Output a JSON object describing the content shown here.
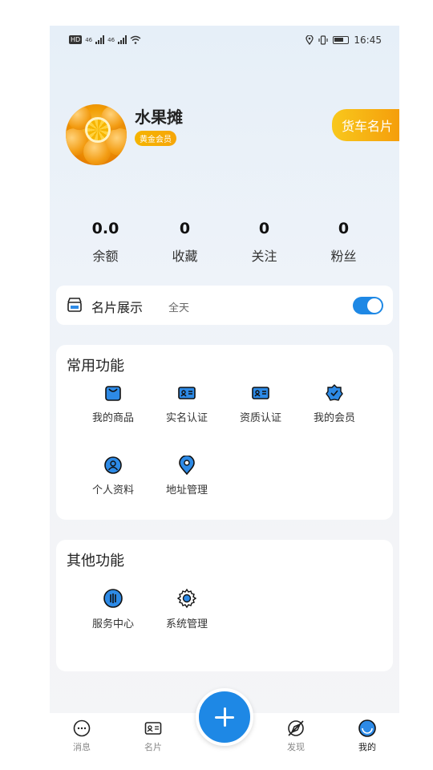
{
  "status_bar": {
    "time": "16:45",
    "hd_label": "HD",
    "net_label": "46"
  },
  "profile": {
    "name": "水果摊",
    "badge": "黄金会员",
    "truck_card_button": "货车名片"
  },
  "stats": [
    {
      "value": "0.0",
      "label": "余额"
    },
    {
      "value": "0",
      "label": "收藏"
    },
    {
      "value": "0",
      "label": "关注"
    },
    {
      "value": "0",
      "label": "粉丝"
    }
  ],
  "card_display": {
    "title": "名片展示",
    "subtitle": "全天",
    "toggle_on": true
  },
  "common_functions": {
    "title": "常用功能",
    "items": [
      {
        "label": "我的商品",
        "icon": "shopping-bag-icon"
      },
      {
        "label": "实名认证",
        "icon": "id-card-icon"
      },
      {
        "label": "资质认证",
        "icon": "certificate-icon"
      },
      {
        "label": "我的会员",
        "icon": "membership-badge-icon"
      },
      {
        "label": "个人资料",
        "icon": "person-icon"
      },
      {
        "label": "地址管理",
        "icon": "location-pin-icon"
      }
    ]
  },
  "other_functions": {
    "title": "其他功能",
    "items": [
      {
        "label": "服务中心",
        "icon": "service-icon"
      },
      {
        "label": "系统管理",
        "icon": "gear-icon"
      }
    ]
  },
  "bottom_nav": {
    "items": [
      {
        "label": "消息",
        "icon": "chat-icon"
      },
      {
        "label": "名片",
        "icon": "card-icon"
      },
      {
        "label": "发现",
        "icon": "compass-icon"
      },
      {
        "label": "我的",
        "icon": "profile-icon",
        "active": true
      }
    ],
    "fab_icon": "plus-icon"
  },
  "colors": {
    "accent": "#1e88e5",
    "gold": "#f5b400",
    "icon_fill": "#2d8ae6"
  }
}
